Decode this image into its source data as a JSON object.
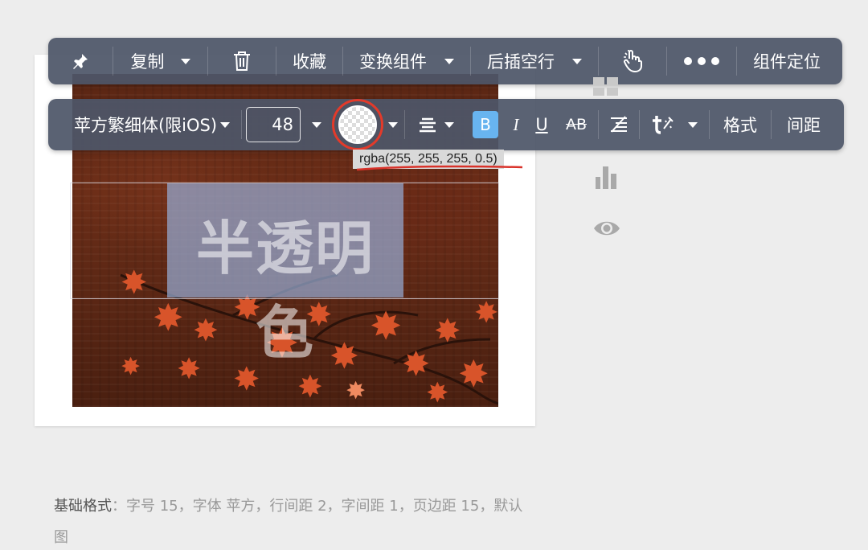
{
  "toolbar1": {
    "pin_icon": "pin-icon",
    "copy_label": "复制",
    "delete_icon": "trash-icon",
    "favorite_label": "收藏",
    "transform_label": "变换组件",
    "insert_after_label": "后插空行",
    "touch_icon": "hand-pointer-icon",
    "more_icon": "more-dots-icon",
    "locate_label": "组件定位"
  },
  "toolbar2": {
    "font_name": "苹方繁细体(限iOS)",
    "font_size": "48",
    "color_swatch_value": "rgba(255, 255, 255, 0.5)",
    "align_icon": "align-center-icon",
    "bold_label": "B",
    "italic_label": "I",
    "underline_label": "U",
    "strike_label": "AB",
    "clear_format_icon": "clear-format-icon",
    "text_effect_icon": "text-effect-icon",
    "format_label": "格式",
    "spacing_label": "间距"
  },
  "tooltip": {
    "text": "rgba(255, 255, 255, 0.5)"
  },
  "canvas": {
    "text": "半透明色"
  },
  "side_icons": [
    "layout-icon",
    "bar-chart-icon",
    "eye-icon"
  ],
  "footer": {
    "label": "基础格式",
    "text": "：字号 15，字体 苹方，行间距 2，字间距 1，页边距 15，默认图"
  },
  "colors": {
    "toolbar_bg": "#4e5668",
    "accent_blue": "#68b4f0",
    "highlight_red": "#e33a2a",
    "text_selection": "#96aad2"
  }
}
